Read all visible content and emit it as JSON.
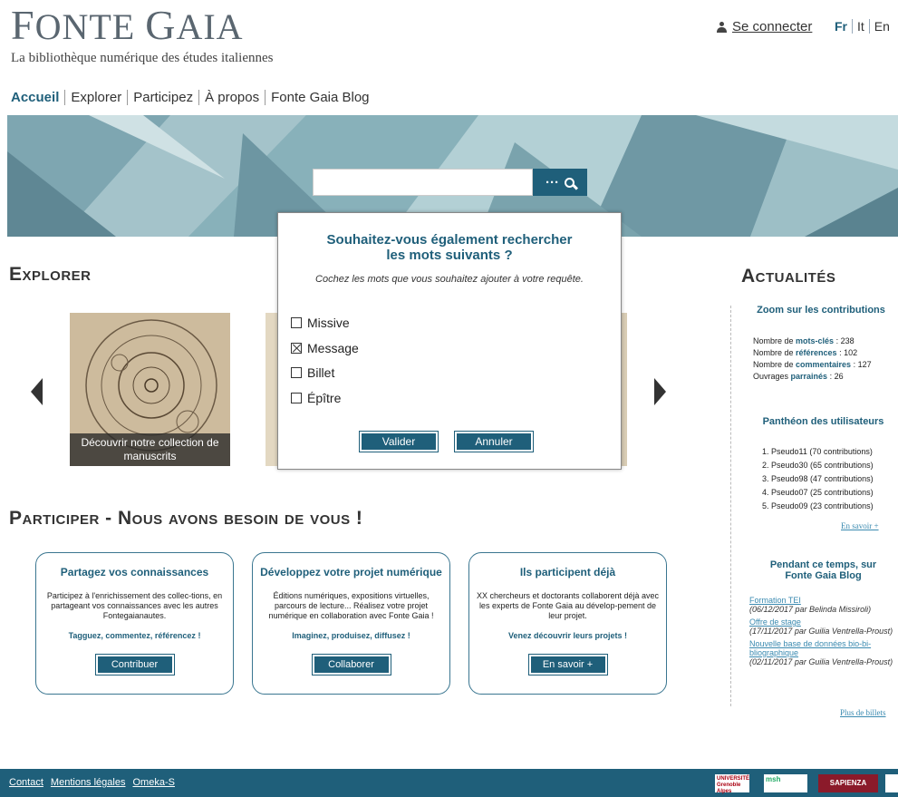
{
  "header": {
    "logo_title_initial1": "F",
    "logo_title_mid": "ONTE ",
    "logo_title_initial2": "G",
    "logo_title_end": "AIA",
    "subtitle": "La bibliothèque numérique des études italiennes",
    "login": "Se connecter",
    "languages": [
      "Fr",
      "It",
      "En"
    ]
  },
  "nav": [
    "Accueil",
    "Explorer",
    "Participez",
    "À propos",
    "Fonte Gaia Blog"
  ],
  "search": {
    "button_label": "···",
    "value": ""
  },
  "explorer": {
    "title": "Explorer",
    "card_caption": "Découvrir notre collection de manuscrits"
  },
  "modal": {
    "title_line1": "Souhaitez-vous également rechercher",
    "title_line2": "les mots suivants ?",
    "subtitle": "Cochez les mots que vous souhaitez ajouter à votre requête.",
    "options": [
      {
        "label": "Missive",
        "checked": false
      },
      {
        "label": "Message",
        "checked": true
      },
      {
        "label": "Billet",
        "checked": false
      },
      {
        "label": "Épître",
        "checked": false
      }
    ],
    "ok": "Valider",
    "cancel": "Annuler"
  },
  "participer": {
    "title": "Participer - Nous avons besoin de vous !",
    "boxes": [
      {
        "title": "Partagez vos connaissances",
        "text": "Participez à l'enrichissement des collec-tions, en partageant vos connaissances avec les autres Fontegaianautes.",
        "cta": "Tagguez, commentez, référencez !",
        "button": "Contribuer"
      },
      {
        "title": "Développez votre projet numérique",
        "text": "Éditions numériques, expositions virtuelles, parcours de lecture... Réalisez votre projet numérique en collaboration avec Fonte Gaia !",
        "cta": "Imaginez, produisez, diffusez !",
        "button": "Collaborer"
      },
      {
        "title": "Ils participent déjà",
        "text": "XX chercheurs et doctorants collaborent déjà avec les experts de Fonte Gaia au dévelop-pement de leur projet.",
        "cta": "Venez découvrir leurs projets !",
        "button": "En savoir +"
      }
    ]
  },
  "actualites": {
    "title": "Actualités",
    "zoom_title": "Zoom sur les contributions",
    "stats": [
      {
        "pre": "Nombre de ",
        "key": "mots-clés",
        "val": " : 238"
      },
      {
        "pre": "Nombre de ",
        "key": "références",
        "val": " : 102"
      },
      {
        "pre": "Nombre de ",
        "key": "commentaires",
        "val": " : 127"
      },
      {
        "pre": "Ouvrages ",
        "key": "parrainés",
        "val": " : 26"
      }
    ],
    "pantheon_title": "Panthéon des utilisateurs",
    "pantheon": [
      "1. Pseudo11 (70 contributions)",
      "2. Pseudo30 (65 contributions)",
      "3. Pseudo98 (47 contributions)",
      "4. Pseudo07 (25 contributions)",
      "5. Pseudo09 (23 contributions)"
    ],
    "en_savoir": "En savoir +",
    "blog_title_line1": "Pendant ce temps, sur",
    "blog_title_line2": "Fonte Gaia Blog",
    "blog": [
      {
        "title": "Formation TEI",
        "meta": "(06/12/2017 par Belinda Missiroli)"
      },
      {
        "title": "Offre de stage",
        "meta": "(17/11/2017 par Guilia Ventrella-Proust)"
      },
      {
        "title": "Nouvelle base de données bio-bi-bliographique",
        "meta": "(02/11/2017 par Guilia Ventrella-Proust)"
      }
    ],
    "more_posts": "Plus de billets"
  },
  "footer": {
    "links": [
      "Contact",
      "Mentions légales",
      "Omeka-S"
    ],
    "partner1": "UNIVERSITÉ Grenoble Alpes",
    "partner2": "msh",
    "partner3": "SAPIENZA"
  }
}
